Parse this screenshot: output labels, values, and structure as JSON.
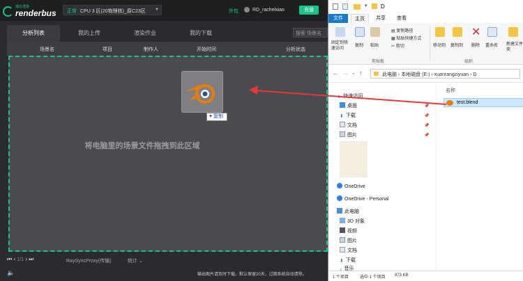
{
  "renderbus": {
    "logo_small": "瑞云渲染",
    "logo_text": "renderbus",
    "status": "正常",
    "server": "CPU 3 区(20物理核)_原C23区",
    "waibao": "外包",
    "user": "RD_rachelxiao",
    "recharge": "充值",
    "tabs": [
      "分析列表",
      "我的上传",
      "渲染作业",
      "我的下载"
    ],
    "search_placeholder": "搜索 场景名",
    "columns": [
      "场景名",
      "项目",
      "制作人",
      "开始时间",
      "分析状态"
    ],
    "drop_text": "将电脑里的场景文件拖拽到此区域",
    "copy_badge": "复制",
    "pager": "1/1",
    "proxy": "RaySyncProxy(传输)",
    "stats": "统计",
    "notice": "输出图片请及时下载，默认保留20天，过期系统自动清除。"
  },
  "explorer": {
    "title": "D",
    "ribbon_tabs": [
      "文件",
      "主页",
      "共享",
      "查看"
    ],
    "ribbon_items": {
      "pin": "固定到快速访问",
      "copy": "复制",
      "paste": "粘贴",
      "copy_path": "复制路径",
      "paste_shortcut": "粘贴快捷方式",
      "cut": "剪切",
      "clipboard": "剪贴板",
      "move_to": "移动到",
      "copy_to": "复制到",
      "delete": "删除",
      "rename": "重命名",
      "new_folder": "新建文件夹",
      "organize": "组织"
    },
    "path": [
      "此电脑",
      "本地磁盘 (E:)",
      "xuanrangziyuan",
      "D"
    ],
    "nav": {
      "quick_access": "快速访问",
      "items": [
        "桌面",
        "下载",
        "文档",
        "图片"
      ],
      "onedrive": "OneDrive",
      "onedrive_personal": "OneDrive - Personal",
      "this_pc": "此电脑",
      "pc_items": [
        "3D 对象",
        "视频",
        "图片",
        "文档",
        "下载",
        "音乐"
      ]
    },
    "column_name": "名称",
    "file_name": "test.blend",
    "status": {
      "count": "1 个项目",
      "selected": "选中 1 个项目",
      "size": "873 KB"
    }
  },
  "colors": {
    "accent": "#19c48c",
    "arrow": "#e53935",
    "explorer_blue": "#1979ca"
  }
}
